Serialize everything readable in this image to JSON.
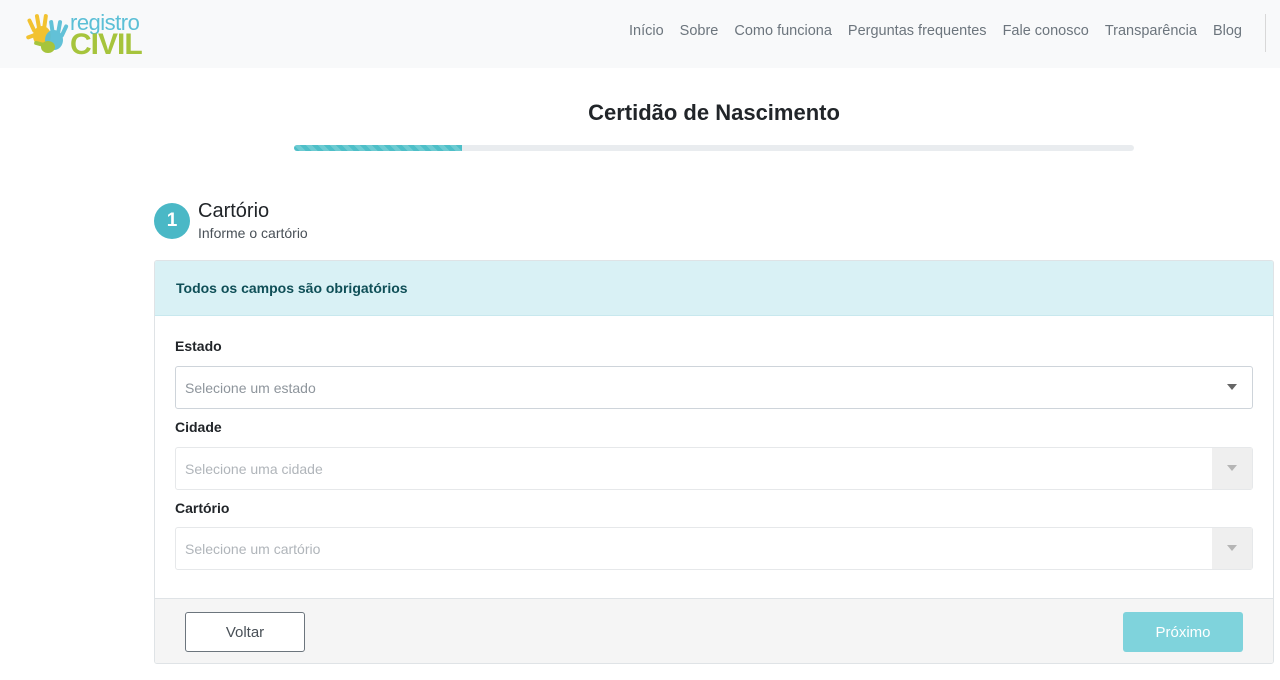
{
  "header": {
    "logo": {
      "line1": "registro",
      "line2": "CIVIL"
    },
    "nav": [
      "Início",
      "Sobre",
      "Como funciona",
      "Perguntas frequentes",
      "Fale conosco",
      "Transparência",
      "Blog"
    ]
  },
  "page": {
    "title": "Certidão de Nascimento",
    "progress_percent": 20
  },
  "step": {
    "number": "1",
    "title": "Cartório",
    "subtitle": "Informe o cartório"
  },
  "form": {
    "alert": "Todos os campos são obrigatórios",
    "fields": [
      {
        "label": "Estado",
        "placeholder": "Selecione um estado",
        "disabled": false
      },
      {
        "label": "Cidade",
        "placeholder": "Selecione uma cidade",
        "disabled": true
      },
      {
        "label": "Cartório",
        "placeholder": "Selecione um cartório",
        "disabled": true
      }
    ]
  },
  "footer": {
    "back_label": "Voltar",
    "next_label": "Próximo"
  },
  "colors": {
    "accent": "#4ab8c6",
    "next_button": "#7fd3dc",
    "alert_bg": "#d9f1f5",
    "logo_blue": "#5bbfd6",
    "logo_green": "#a6c43c"
  }
}
